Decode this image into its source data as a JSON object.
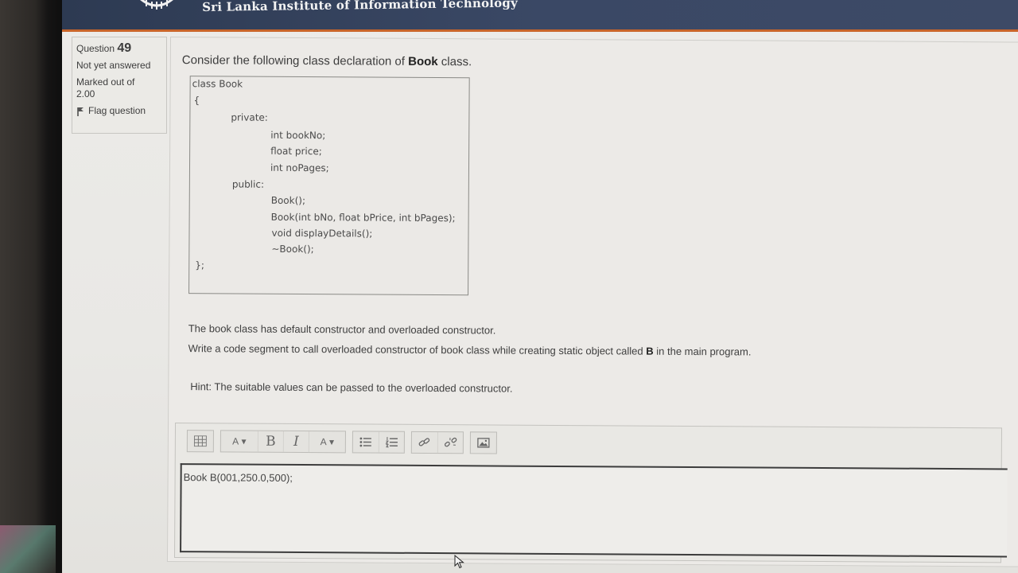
{
  "header": {
    "institution": "Sri Lanka Institute of Information Technology"
  },
  "info": {
    "question_label": "Question",
    "question_number": "49",
    "status": "Not yet answered",
    "marked_out_of_label": "Marked out of",
    "marked_out_of_value": "2.00",
    "flag_label": "Flag question"
  },
  "question": {
    "intro_prefix": "Consider the following class declaration of ",
    "intro_bold": "Book",
    "intro_suffix": " class.",
    "code_lines": [
      "class Book",
      "{",
      "private:",
      "int bookNo;",
      "float price;",
      "int noPages;",
      "public:",
      "Book();",
      "Book(int bNo, float bPrice, int bPages);",
      "void displayDetails();",
      "~Book();",
      "};"
    ],
    "line1": "The book class has default constructor and overloaded constructor.",
    "line2_prefix": "Write a code segment to call overloaded constructor of book class while creating static object called ",
    "line2_bold": "B",
    "line2_suffix": " in the main program.",
    "hint": "Hint: The suitable values can be passed to the overloaded constructor."
  },
  "editor": {
    "toolbar": {
      "font_size": "A",
      "bold": "B",
      "italic": "I",
      "paragraph": "A"
    },
    "answer": "Book B(001,250.0,500);"
  }
}
